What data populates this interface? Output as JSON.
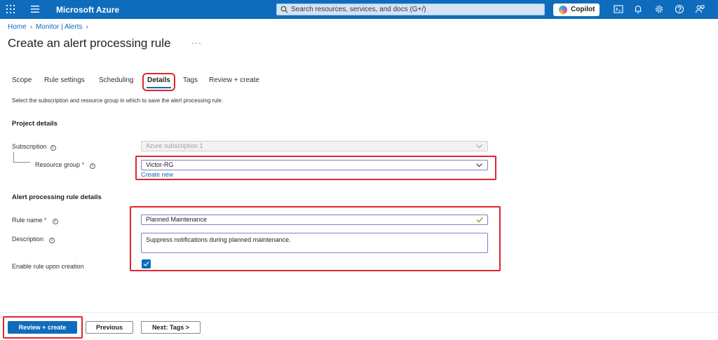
{
  "topbar": {
    "brand": "Microsoft Azure",
    "search_placeholder": "Search resources, services, and docs (G+/)",
    "copilot_label": "Copilot",
    "icons": [
      "waffle-icon",
      "menu-icon",
      "search-icon",
      "copilot-icon",
      "cloud-shell-icon",
      "notifications-icon",
      "settings-icon",
      "help-icon",
      "feedback-icon"
    ]
  },
  "breadcrumb": {
    "items": [
      "Home",
      "Monitor | Alerts"
    ]
  },
  "page": {
    "title": "Create an alert processing rule",
    "more": "···"
  },
  "tabs": [
    {
      "label": "Scope"
    },
    {
      "label": "Rule settings"
    },
    {
      "label": "Scheduling"
    },
    {
      "label": "Details",
      "active": true
    },
    {
      "label": "Tags"
    },
    {
      "label": "Review + create"
    }
  ],
  "intro": "Select the subscription and resource group in which to save the alert processing rule.",
  "project": {
    "heading": "Project details",
    "subscription_label": "Subscription",
    "subscription_value": "Azure subscription 1",
    "rg_label": "Resource group",
    "rg_value": "Victor-RG",
    "create_new": "Create new"
  },
  "rule": {
    "heading": "Alert processing rule details",
    "name_label": "Rule name",
    "name_value": "Planned Maintenance",
    "description_label": "Description",
    "description_value": "Suppress notifications during planned maintenance.",
    "enable_label": "Enable rule upon creation",
    "enabled": true
  },
  "footer": {
    "review_create": "Review + create",
    "previous": "Previous",
    "next": "Next: Tags >"
  },
  "required_mark": "*",
  "info_mark": "i",
  "colors": {
    "accent": "#0f6cbd",
    "highlight": "#e0262c"
  }
}
